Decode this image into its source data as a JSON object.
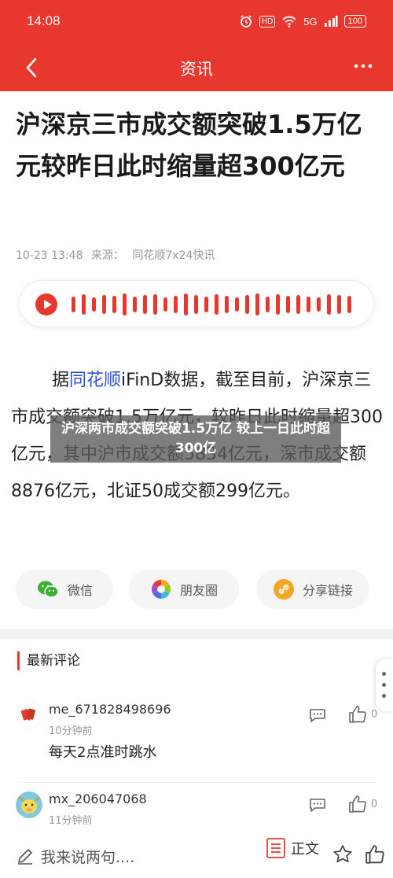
{
  "status_bar": {
    "time": "14:08",
    "hd_label": "HD",
    "network_label": "5G",
    "battery": "100"
  },
  "nav": {
    "title": "资讯"
  },
  "article": {
    "title": "沪深京三市成交额突破1.5万亿元较昨日此时缩量超300亿元",
    "date": "10-23 13:48",
    "source_prefix": "来源：",
    "source": "同花顺7x24快讯",
    "body_prefix": "据",
    "body_link": "同花顺",
    "body_rest": "iFinD数据，截至目前，沪深京三市成交额突破1.5万亿元，较昨日此时缩量超300亿元，其中沪市成交额5834亿元，深市成交额8876亿元，北证50成交额299亿元。",
    "overlay_caption": "沪深两市成交额突破1.5万亿 较上一日此时超300亿"
  },
  "share": {
    "wechat": "微信",
    "moments": "朋友圈",
    "link": "分享链接"
  },
  "comments": {
    "header": "最新评论",
    "items": [
      {
        "user": "me_671828498696",
        "time": "10分钟前",
        "text": "每天2点准时跳水",
        "likes": "0"
      },
      {
        "user": "mx_206047068",
        "time": "11分钟前",
        "text": "",
        "likes": "0"
      }
    ]
  },
  "bottom_bar": {
    "input_placeholder": "我来说两句....",
    "toc_label": "正文"
  },
  "colors": {
    "brand_red": "#e8372e",
    "link_blue": "#2b4fd6"
  }
}
